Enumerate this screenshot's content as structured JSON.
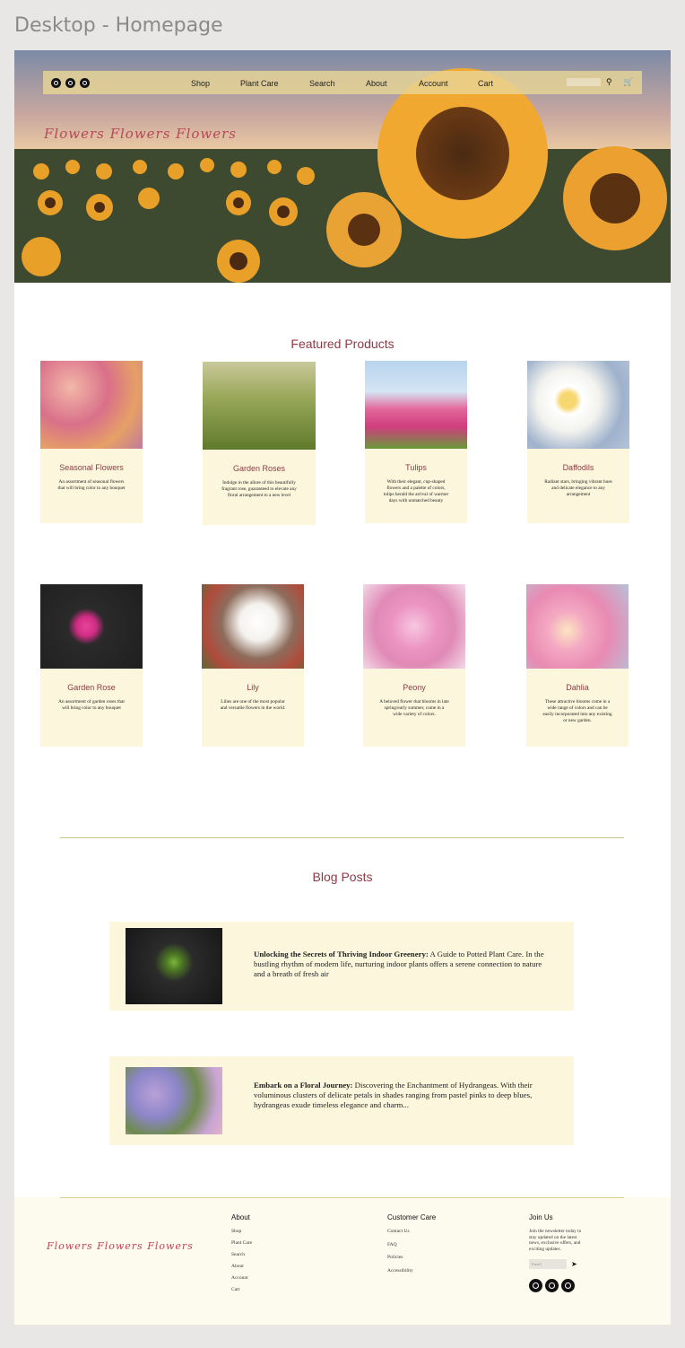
{
  "frame_title": "Desktop - Homepage",
  "nav": {
    "social": [
      "instagram-icon",
      "facebook-icon",
      "pinterest-icon"
    ],
    "links": [
      "Shop",
      "Plant Care",
      "Search",
      "About",
      "Account",
      "Cart"
    ]
  },
  "hero": {
    "brand": "Flowers Flowers Flowers"
  },
  "featured": {
    "title": "Featured Products",
    "products": [
      {
        "name": "Seasonal Flowers",
        "desc": "An assortment of seasonal flowers that will bring color to any bouquet"
      },
      {
        "name": "Garden Roses",
        "desc": "Indulge in the allure of this beautifully fragrant rose, guaranteed to elevate any floral arrangement to a new level"
      },
      {
        "name": "Tulips",
        "desc": "With their elegant, cup-shaped flowers and a palette of colors, tulips herald the arrival of warmer days with unmatched beauty"
      },
      {
        "name": "Daffodils",
        "desc": "Radiant stars, bringing vibrant hues and delicate elegance to any arrangement"
      },
      {
        "name": "Garden Rose",
        "desc": "An assortment of garden roses that will bring color to any bouquet"
      },
      {
        "name": "Lily",
        "desc": "Lilies are one of the most popular and versatile flowers in the world."
      },
      {
        "name": "Peony",
        "desc": "A beloved flower that blooms in late spring/early summer, come in a wide variety of colors."
      },
      {
        "name": "Dahlia",
        "desc": "These attractive blooms come in a wide range of colors and can be easily incorporated into any existing or new garden."
      }
    ]
  },
  "blog": {
    "title": "Blog Posts",
    "posts": [
      {
        "bold": "Unlocking the Secrets of Thriving Indoor Greenery:",
        "text": " A Guide to Potted Plant Care. In the bustling rhythm of modern life, nurturing indoor plants offers a serene connection to nature and a breath of fresh air"
      },
      {
        "bold": "Embark on a Floral Journey:",
        "text": " Discovering the Enchantment of Hydrangeas. With their voluminous clusters of delicate petals in shades ranging from pastel pinks to deep blues, hydrangeas exude timeless elegance and charm..."
      }
    ]
  },
  "footer": {
    "brand": "Flowers Flowers Flowers",
    "about": {
      "title": "About",
      "links": [
        "Shop",
        "Plant Care",
        "Search",
        "About",
        "Account",
        "Cart"
      ]
    },
    "care": {
      "title": "Customer Care",
      "links": [
        "Contact Us",
        "FAQ",
        "Policies",
        "Accessibility"
      ]
    },
    "join": {
      "title": "Join Us",
      "text": "Join the newsletter today to stay updated on the latest news, exclusive offers, and exciting updates.",
      "email_placeholder": "Email"
    }
  }
}
